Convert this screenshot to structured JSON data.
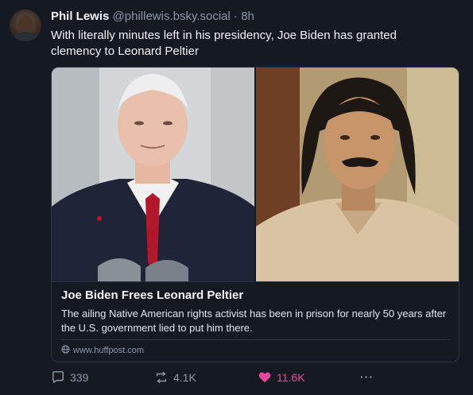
{
  "post": {
    "author_name": "Phil Lewis",
    "handle": "@phillewis.bsky.social",
    "separator": "·",
    "time": "8h",
    "text": "With literally minutes left in his presidency, Joe Biden has granted clemency to Leonard Peltier"
  },
  "card": {
    "title": "Joe Biden Frees Leonard Peltier",
    "description": "The ailing Native American rights activist has been in prison for nearly 50 years after the U.S. government lied to put him there.",
    "domain": "www.huffpost.com"
  },
  "actions": {
    "replies": "339",
    "reposts": "4.1K",
    "likes": "11.6K",
    "more_label": "···"
  },
  "colors": {
    "background": "#151922",
    "muted_text": "#8c98a8",
    "like_accent": "#ec4899",
    "border": "#2c3442"
  },
  "icons": {
    "reply": "speech-bubble-icon",
    "repost": "repost-arrows-icon",
    "like": "heart-icon",
    "more": "ellipsis-icon",
    "globe": "globe-icon"
  }
}
